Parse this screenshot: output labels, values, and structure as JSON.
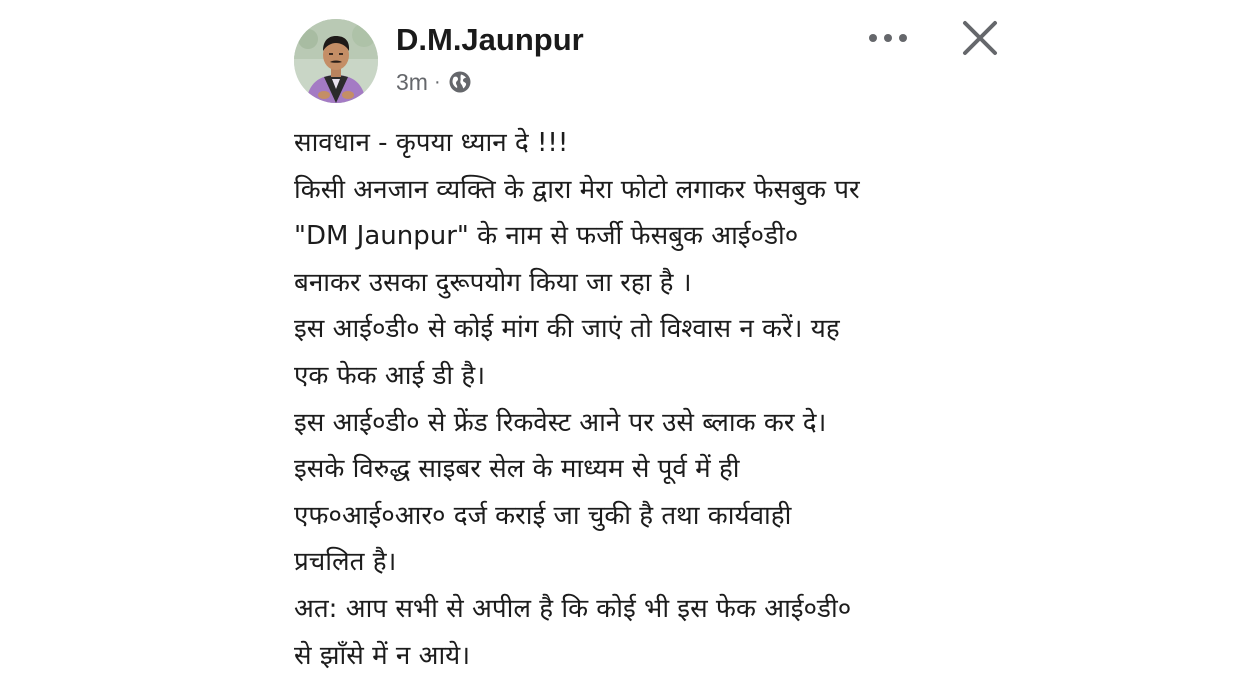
{
  "post": {
    "author": "D.M.Jaunpur",
    "time": "3m",
    "separator": "·",
    "privacy_icon": "globe-icon",
    "more_icon": "more-options-icon",
    "close_icon": "close-icon",
    "lines": [
      "सावधान - कृपया ध्यान दे !!!",
      "किसी अनजान व्यक्ति के द्वारा मेरा फोटो लगाकर फेसबुक पर",
      "\"DM Jaunpur\" के नाम से फर्जी फेसबुक आई०डी०",
      "बनाकर उसका दुरूपयोग किया जा रहा है ।",
      "इस आई०डी० से कोई मांग की जाएं तो विश्वास न करें। यह",
      "एक फेक आई डी है।",
      "इस आई०डी० से फ्रेंड रिकवेस्ट आने पर उसे ब्लाक कर दे।",
      "इसके विरुद्ध साइबर सेल के माध्यम से पूर्व में ही",
      "एफ०आई०आर० दर्ज कराई जा चुकी है तथा कार्यवाही",
      "प्रचलित है।",
      "अत: आप सभी से अपील है कि कोई भी इस फेक आई०डी०",
      "से झाँसे में न आये।"
    ]
  },
  "colors": {
    "text": "#1c1c1c",
    "meta": "#65676b",
    "icon": "#65676b"
  }
}
